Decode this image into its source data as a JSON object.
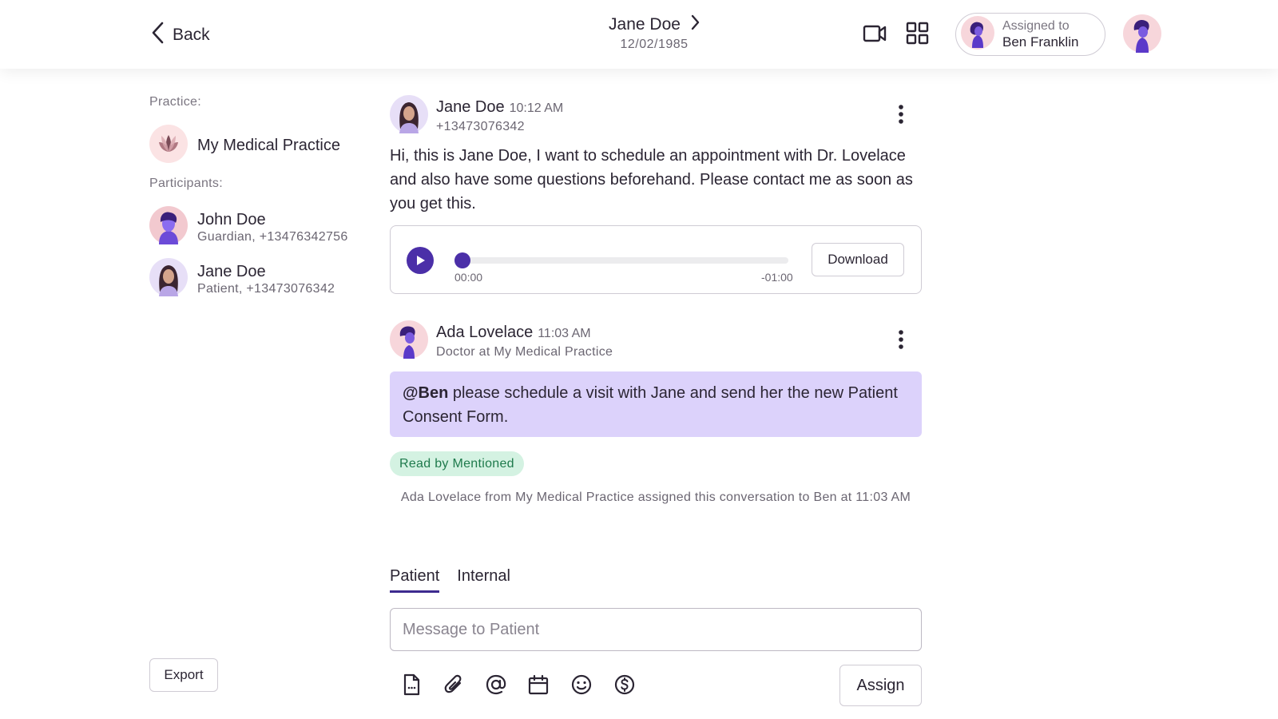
{
  "header": {
    "back_label": "Back",
    "patient_name": "Jane Doe",
    "patient_dob": "12/02/1985",
    "icons": [
      "chevron-left-icon",
      "chevron-right-icon",
      "video-camera-icon",
      "grid-icon"
    ],
    "assigned_caption": "Assigned to",
    "assigned_name": "Ben Franklin"
  },
  "sidebar": {
    "practice_label": "Practice:",
    "practice_name": "My Medical Practice",
    "participants_label": "Participants:",
    "participants": [
      {
        "name": "John Doe",
        "detail": "Guardian, +13476342756"
      },
      {
        "name": "Jane Doe",
        "detail": "Patient, +13473076342"
      }
    ],
    "export_label": "Export"
  },
  "messages": [
    {
      "author": "Jane Doe",
      "time": "10:12 AM",
      "subtitle": "+13473076342",
      "text": "Hi, this is Jane Doe, I want to schedule an appointment with Dr. Lovelace and also have some questions beforehand. Please contact me as soon as you get this.",
      "audio": {
        "elapsed": "00:00",
        "remaining": "-01:00",
        "progress": 0.0,
        "download_label": "Download"
      }
    },
    {
      "author": "Ada Lovelace",
      "time": "11:03 AM",
      "subtitle": "Doctor at My Medical Practice",
      "mention": "@Ben",
      "text": " please schedule a visit with Jane and send her the new Patient Consent Form.",
      "read_badge": "Read by Mentioned"
    }
  ],
  "system_note": "Ada Lovelace from My Medical Practice assigned this conversation to Ben at 11:03 AM",
  "composer": {
    "tabs": [
      {
        "label": "Patient",
        "active": true
      },
      {
        "label": "Internal",
        "active": false
      }
    ],
    "placeholder": "Message to Patient",
    "tools": [
      "document-icon",
      "paperclip-icon",
      "at-sign-icon",
      "calendar-icon",
      "emoji-icon",
      "dollar-icon"
    ],
    "assign_label": "Assign"
  },
  "colors": {
    "accent": "#4b2fa8",
    "internal_note_bg": "#dcd2fb",
    "read_badge_bg": "#d4f2e2",
    "read_badge_text": "#1e7a4c"
  }
}
